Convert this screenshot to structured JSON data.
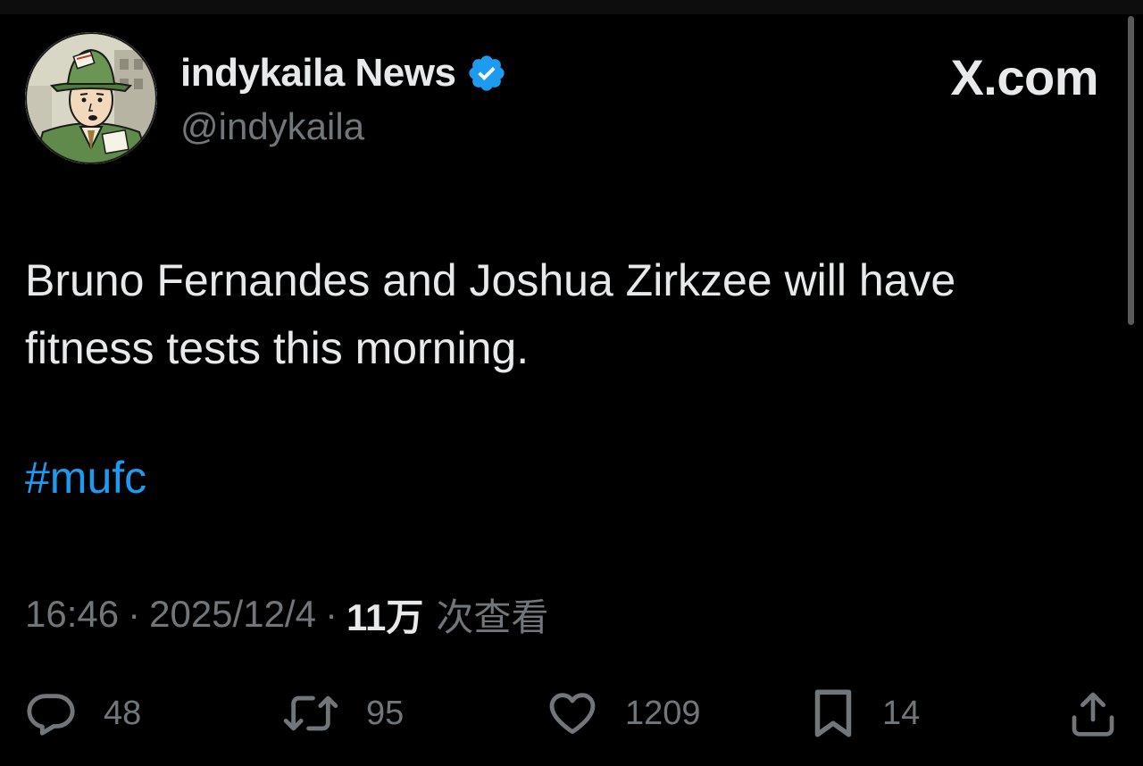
{
  "header": {
    "display_name": "indykaila News",
    "handle": "@indykaila",
    "site_mark": "X.com",
    "verified_icon": "verified-badge-icon",
    "avatar_icon": "press-reporter-avatar"
  },
  "tweet": {
    "text": "Bruno Fernandes and Joshua Zirkzee will have fitness tests this morning.",
    "hashtag": "#mufc"
  },
  "meta": {
    "time": "16:46",
    "separator": "·",
    "date": "2025/12/4",
    "views_count": "11万",
    "views_label": "次查看"
  },
  "actions": {
    "reply": {
      "icon": "reply-bubble-icon",
      "count": "48"
    },
    "retweet": {
      "icon": "retweet-icon",
      "count": "95"
    },
    "like": {
      "icon": "heart-icon",
      "count": "1209"
    },
    "bookmark": {
      "icon": "bookmark-icon",
      "count": "14"
    },
    "share": {
      "icon": "share-icon"
    }
  },
  "colors": {
    "background": "#000000",
    "primary_text": "#e7e9ea",
    "secondary_text": "#71767b",
    "link": "#1d9bf0",
    "verified": "#1d9bf0"
  }
}
